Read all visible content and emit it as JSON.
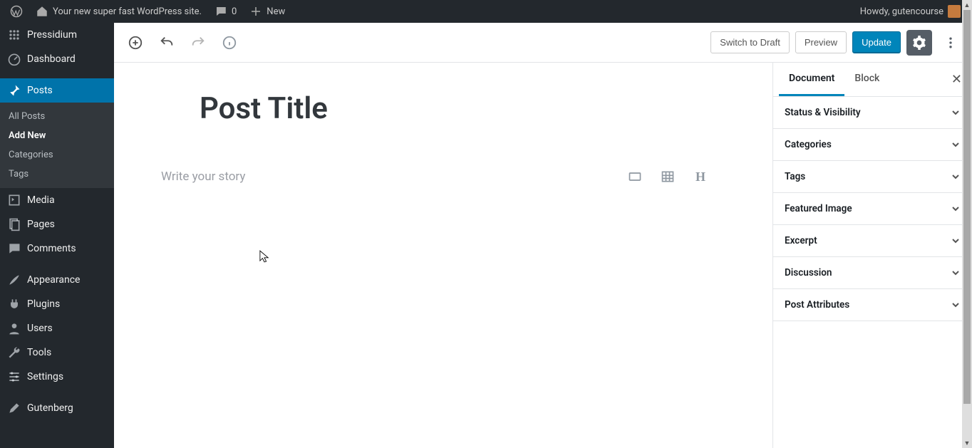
{
  "adminbar": {
    "site_name": "Your new super fast WordPress site.",
    "comments_count": "0",
    "new_label": "New",
    "howdy": "Howdy, gutencourse"
  },
  "sidebar": {
    "items": [
      {
        "label": "Pressidium"
      },
      {
        "label": "Dashboard"
      },
      {
        "label": "Posts"
      },
      {
        "label": "Media"
      },
      {
        "label": "Pages"
      },
      {
        "label": "Comments"
      },
      {
        "label": "Appearance"
      },
      {
        "label": "Plugins"
      },
      {
        "label": "Users"
      },
      {
        "label": "Tools"
      },
      {
        "label": "Settings"
      },
      {
        "label": "Gutenberg"
      }
    ],
    "submenu": [
      {
        "label": "All Posts"
      },
      {
        "label": "Add New"
      },
      {
        "label": "Categories"
      },
      {
        "label": "Tags"
      }
    ]
  },
  "toolbar": {
    "switch_draft": "Switch to Draft",
    "preview": "Preview",
    "update": "Update"
  },
  "editor": {
    "title": "Post Title",
    "placeholder": "Write your story"
  },
  "settings": {
    "tab_document": "Document",
    "tab_block": "Block",
    "panels": [
      {
        "title": "Status & Visibility"
      },
      {
        "title": "Categories"
      },
      {
        "title": "Tags"
      },
      {
        "title": "Featured Image"
      },
      {
        "title": "Excerpt"
      },
      {
        "title": "Discussion"
      },
      {
        "title": "Post Attributes"
      }
    ]
  }
}
